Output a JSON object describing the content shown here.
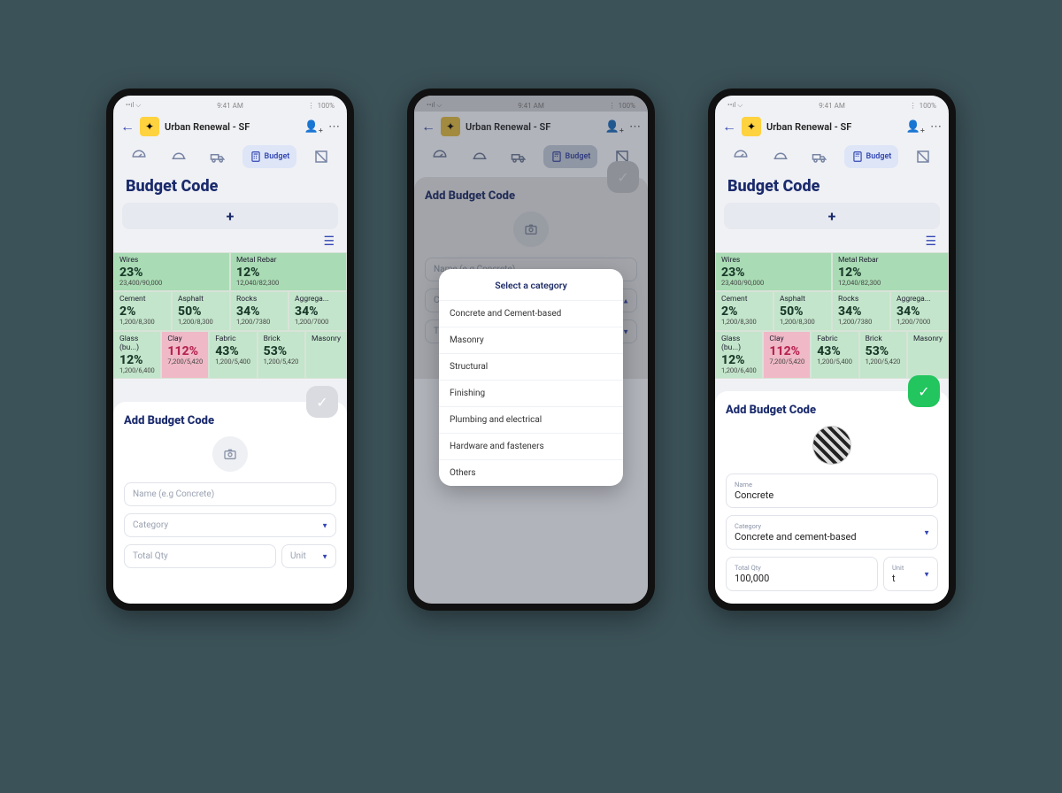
{
  "status": {
    "time": "9:41 AM",
    "battery": "100%"
  },
  "header": {
    "title": "Urban Renewal - SF"
  },
  "tabs": {
    "budget_label": "Budget"
  },
  "page_title": "Budget Code",
  "tiles": {
    "wires": {
      "name": "Wires",
      "pct": "23%",
      "sub": "23,400/90,000"
    },
    "rebar": {
      "name": "Metal Rebar",
      "pct": "12%",
      "sub": "12,040/82,300"
    },
    "cement": {
      "name": "Cement",
      "pct": "2%",
      "sub": "1,200/8,300"
    },
    "asphalt": {
      "name": "Asphalt",
      "pct": "50%",
      "sub": "1,200/8,300"
    },
    "rocks": {
      "name": "Rocks",
      "pct": "34%",
      "sub": "1,200/7380"
    },
    "agg": {
      "name": "Aggrega...",
      "pct": "34%",
      "sub": "1,200/7000"
    },
    "glass": {
      "name": "Glass (bu...)",
      "pct": "12%",
      "sub": "1,200/6,400"
    },
    "clay": {
      "name": "Clay",
      "pct": "112%",
      "sub": "7,200/5,420"
    },
    "fabric": {
      "name": "Fabric",
      "pct": "43%",
      "sub": "1,200/5,400"
    },
    "brick": {
      "name": "Brick",
      "pct": "53%",
      "sub": "1,200/5,420"
    },
    "masonry": {
      "name": "Masonry"
    }
  },
  "sheet": {
    "title": "Add Budget Code",
    "name_ph": "Name (e.g Concrete)",
    "cat_ph": "Category",
    "qty_ph": "Total Qty",
    "unit_ph": "Unit"
  },
  "popup": {
    "title": "Select a category",
    "opts": [
      "Concrete and Cement-based",
      "Masonry",
      "Structural",
      "Finishing",
      "Plumbing and electrical",
      "Hardware and fasteners",
      "Others"
    ]
  },
  "filled": {
    "name_lab": "Name",
    "name_val": "Concrete",
    "cat_lab": "Category",
    "cat_val": "Concrete and cement-based",
    "qty_lab": "Total Qty",
    "qty_val": "100,000",
    "unit_lab": "Unit",
    "unit_val": "t"
  }
}
